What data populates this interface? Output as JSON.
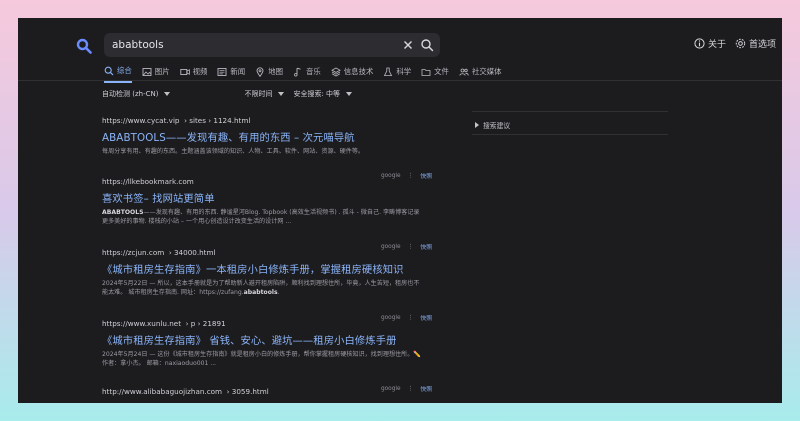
{
  "search": {
    "query": "ababtools"
  },
  "header": {
    "about_label": "关于",
    "prefs_label": "首选项"
  },
  "tabs": [
    {
      "label": "综合",
      "icon": "search-icon"
    },
    {
      "label": "图片",
      "icon": "image-icon"
    },
    {
      "label": "视频",
      "icon": "video-icon"
    },
    {
      "label": "新闻",
      "icon": "news-icon"
    },
    {
      "label": "地图",
      "icon": "map-pin-icon"
    },
    {
      "label": "音乐",
      "icon": "music-icon"
    },
    {
      "label": "信息技术",
      "icon": "layers-icon"
    },
    {
      "label": "科学",
      "icon": "flask-icon"
    },
    {
      "label": "文件",
      "icon": "folder-icon"
    },
    {
      "label": "社交媒体",
      "icon": "people-icon"
    }
  ],
  "filters": {
    "language": "自动检测 (zh-CN)",
    "time": "不限时间",
    "safe_search": "安全搜索: 中等"
  },
  "sidebar": {
    "suggestions_label": "搜索建议"
  },
  "results": [
    {
      "url": "https://www.cycat.vip",
      "path": "› sites › 1124.html",
      "title": "ABABTOOLS——发现有趣、有用的东西 – 次元喵导航",
      "snippet_pre": "每周分享有用、有趣的东西。主题涵盖该领域的知识、人物、工具、软件、网站、资源、硬件等。",
      "snippet_bold": "",
      "snippet_post": "",
      "engine": "google",
      "cache": "快照"
    },
    {
      "url": "https://llkebookmark.com",
      "path": "",
      "title": "喜欢书签– 找网站更简单",
      "snippet_pre": "",
      "snippet_bold": "ABABTOOLS",
      "snippet_post": "——发现有趣、有用的东西. 静谧星河Blog. Topbook (高效生活视频书) . 孤斗 - 微自己. 李畴博客记录更多美好的事物. 楼栈的小站 – 一个用心创造设计改变生活的设计网 ...",
      "engine": "google",
      "cache": "快照"
    },
    {
      "url": "https://zcjun.com",
      "path": "› 34000.html",
      "title": "《城市租房生存指南》一本租房小白修炼手册，掌握租房硬核知识",
      "snippet_pre": "2024年5月22日 — 所以，这本手册就是为了帮助新人避开租房陷阱，顺利找到理想住所，毕竟，人生苦短，租房也不能太难。 城市租房生存指南. 网址：https://zufang.",
      "snippet_bold": "ababtools",
      "snippet_post": ".",
      "engine": "google",
      "cache": "快照"
    },
    {
      "url": "https://www.xunlu.net",
      "path": "› p › 21891",
      "title": "《城市租房生存指南》 省钱、安心、避坑——租房小白修炼手册",
      "snippet_pre": "2024年5月24日 — 这份《城市租房生存指南》就是租房小白的修炼手册，帮你掌握租房硬核知识，找到理想住所。✏️作者：拿小杰。 邮箱：naxiaoduo001 ...",
      "snippet_bold": "",
      "snippet_post": "",
      "engine": "google",
      "cache": "快照"
    },
    {
      "url": "http://www.alibabaguojizhan.com",
      "path": "› 3059.html",
      "title": "",
      "snippet_pre": "",
      "snippet_bold": "",
      "snippet_post": "",
      "engine": "",
      "cache": ""
    }
  ]
}
